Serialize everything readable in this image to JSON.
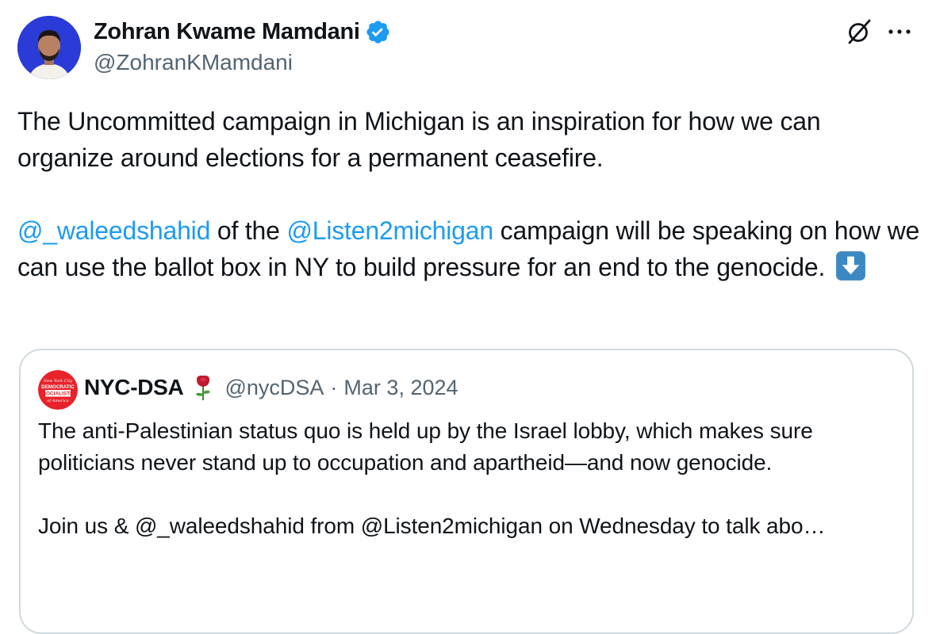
{
  "author": {
    "name": "Zohran Kwame Mamdani",
    "handle": "@ZohranKMamdani",
    "avatar_bg": "#2a3bd8"
  },
  "icons": {
    "verified": "verified-badge-icon",
    "grok": "grok-icon",
    "more": "more-options-icon",
    "emoji": "down-arrow-emoji-icon"
  },
  "tweet": {
    "line1": "The Uncommitted campaign in Michigan is an inspiration for how we can organize around elections for a permanent ceasefire.",
    "mention1": "@_waleedshahid",
    "text_a": " of the ",
    "mention2": "@Listen2michigan",
    "text_b": " campaign will be speaking on how we can use the ballot box in NY to build pressure for an end to the genocide. "
  },
  "quote": {
    "name": "NYC-DSA",
    "handle": "@nycDSA",
    "separator": "·",
    "date": "Mar 3, 2024",
    "para1": "The anti-Palestinian status quo is held up by the Israel lobby, which makes sure politicians never stand up to occupation and apartheid—and now genocide.",
    "para2": "Join us & @_waleedshahid from @Listen2michigan on Wednesday to talk abo…",
    "logo_text": [
      "New York City",
      "DEMOCRATIC",
      "SOCIALISTS",
      "of America"
    ],
    "logo_color": "#e8222a"
  },
  "colors": {
    "link": "#1d9bf0",
    "secondary": "#536471",
    "border": "#cfd9de",
    "verified": "#1d9bf0"
  }
}
